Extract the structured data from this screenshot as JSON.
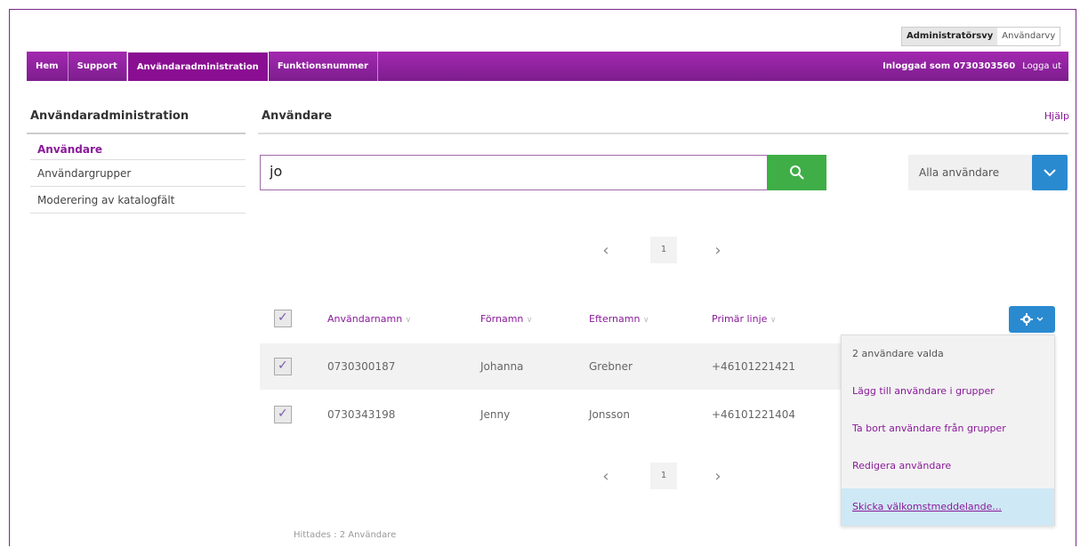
{
  "view_switch": {
    "admin": "Administratörsvy",
    "user": "Användarvy"
  },
  "nav": {
    "items": [
      "Hem",
      "Support",
      "Användaradministration",
      "Funktionsnummer"
    ],
    "logged_in": "Inloggad som 0730303560",
    "logout": "Logga ut"
  },
  "sidebar": {
    "title": "Användaradministration",
    "items": [
      "Användare",
      "Användargrupper",
      "Moderering av katalogfält"
    ]
  },
  "main": {
    "title": "Användare",
    "help": "Hjälp"
  },
  "search": {
    "value": "jo"
  },
  "filter": {
    "label": "Alla användare"
  },
  "pager": {
    "page": "1"
  },
  "table": {
    "headers": [
      "Användarnamn",
      "Förnamn",
      "Efternamn",
      "Primär linje"
    ],
    "rows": [
      {
        "username": "0730300187",
        "first": "Johanna",
        "last": "Grebner",
        "line": "+46101221421",
        "selected": true
      },
      {
        "username": "0730343198",
        "first": "Jenny",
        "last": "Jonsson",
        "line": "+46101221404",
        "selected": true
      }
    ]
  },
  "menu": {
    "header": "2 användare valda",
    "items": [
      "Lägg till användare i grupper",
      "Ta bort användare från grupper",
      "Redigera användare",
      "Skicka välkomstmeddelande..."
    ]
  },
  "found": "Hittades : 2 Användare",
  "colors": {
    "brand": "#8a1a9a",
    "search_button": "#3fae47",
    "accent_blue": "#2a8ad0"
  },
  "icons": {
    "search": "search-icon",
    "chevron": "chevron-down-icon",
    "gear": "gear-icon"
  }
}
